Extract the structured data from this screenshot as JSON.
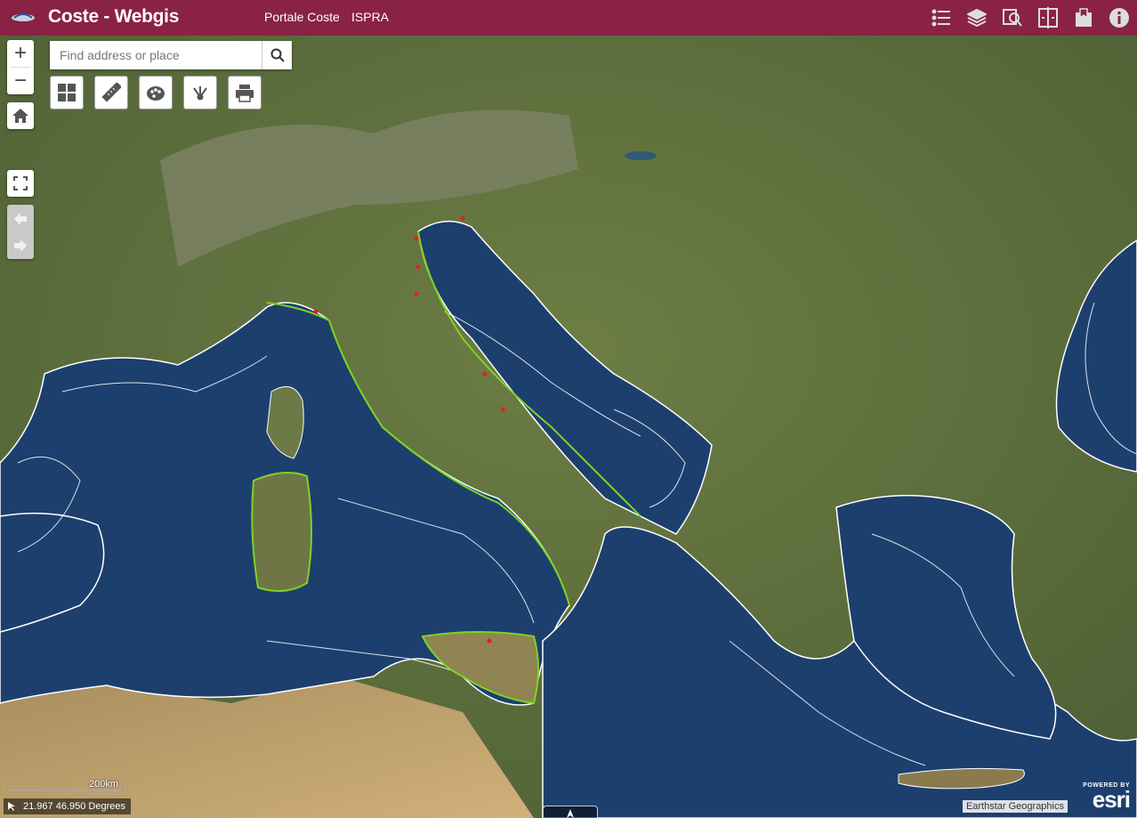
{
  "header": {
    "title": "Coste - Webgis",
    "links": [
      "Portale Coste",
      "ISPRA"
    ],
    "icons": [
      "legend-icon",
      "layers-icon",
      "search-layer-icon",
      "swipe-icon",
      "bookmark-icon",
      "info-icon"
    ]
  },
  "zoom": {
    "in": "+",
    "out": "−"
  },
  "search": {
    "placeholder": "Find address or place",
    "value": ""
  },
  "toolbar": {
    "tools": [
      "basemap-gallery-icon",
      "measure-icon",
      "draw-icon",
      "share-icon",
      "print-icon"
    ]
  },
  "map": {
    "scale_label": "200km",
    "coordinates": "21.967 46.950 Degrees",
    "attribution": "Earthstar Geographics",
    "esri_powered": "POWERED BY",
    "esri_brand": "esri"
  },
  "colors": {
    "header": "#8a2245",
    "sea": "#1d3f6e",
    "land": "#5f7440",
    "bathymetry_lines": "#ffffff",
    "coast_green": "#7ed321",
    "coast_red": "#e02020"
  }
}
